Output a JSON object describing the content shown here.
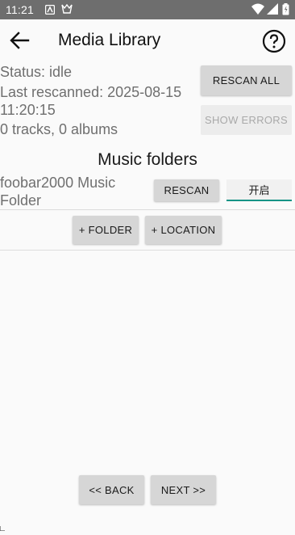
{
  "status_bar": {
    "time": "11:21"
  },
  "app_bar": {
    "title": "Media Library",
    "back_icon": "arrow-back-icon",
    "help_icon": "help-circle-icon"
  },
  "library": {
    "status": "Status: idle",
    "last_rescanned": "Last rescanned: 2025-08-15",
    "last_rescanned_time": "11:20:15",
    "counts": "0 tracks, 0 albums",
    "rescan_all_label": "RESCAN ALL",
    "show_errors_label": "SHOW ERRORS"
  },
  "folders": {
    "section_title": "Music folders",
    "items": [
      {
        "name_line1": "foobar2000 Music",
        "name_line2": "Folder",
        "rescan_label": "RESCAN",
        "mode_value": "开启"
      }
    ],
    "add_folder_label": "+ FOLDER",
    "add_location_label": "+ LOCATION"
  },
  "nav": {
    "back_label": "<< BACK",
    "next_label": "NEXT >>"
  },
  "colors": {
    "statusbar_bg": "#6e6e6e",
    "accent": "#159486",
    "button_bg": "#d6d6d6"
  }
}
